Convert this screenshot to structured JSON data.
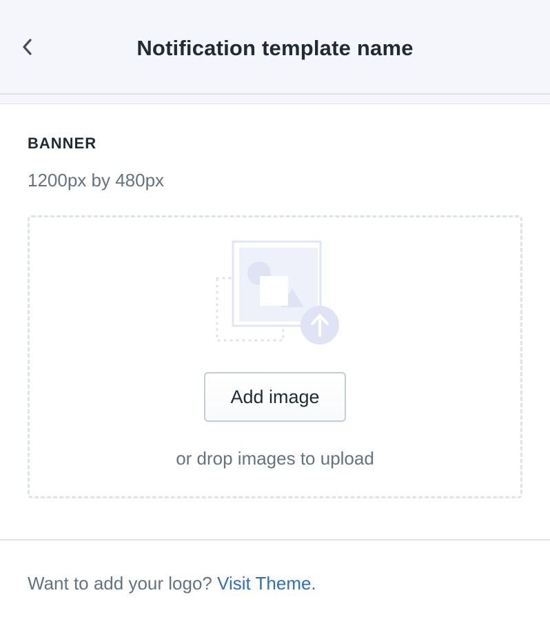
{
  "header": {
    "title": "Notification template name",
    "back_icon": "chevron-left-icon",
    "background": "#f4f6fb"
  },
  "banner": {
    "label": "BANNER",
    "size_hint": "1200px by 480px",
    "dropzone": {
      "illustration_icon": "image-upload-icon",
      "button_label": "Add image",
      "drop_hint": "or drop images to upload"
    }
  },
  "footer": {
    "prompt": "Want to add your logo?",
    "link_label": "Visit Theme.",
    "link_color": "#2c6ecb"
  },
  "colors": {
    "text_primary": "#212b36",
    "text_secondary": "#637381",
    "border": "#dfe3e8",
    "illustration_fill": "#eef0fa",
    "illustration_accent": "#dfe3f4"
  }
}
